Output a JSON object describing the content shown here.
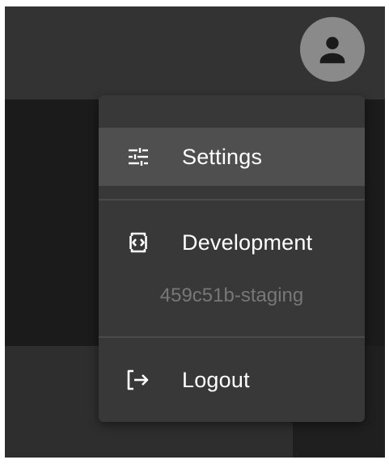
{
  "header": {
    "avatar_icon": "person-icon"
  },
  "menu": {
    "settings": {
      "label": "Settings",
      "icon": "tune-sliders-icon"
    },
    "development": {
      "label": "Development",
      "icon": "code-bracket-icon"
    },
    "environment_id": "459c51b-staging",
    "logout": {
      "label": "Logout",
      "icon": "logout-icon"
    }
  },
  "colors": {
    "menu_background": "#383838",
    "highlight": "#4f4f4f",
    "avatar": "#8a8a8a",
    "muted_text": "#777777"
  }
}
